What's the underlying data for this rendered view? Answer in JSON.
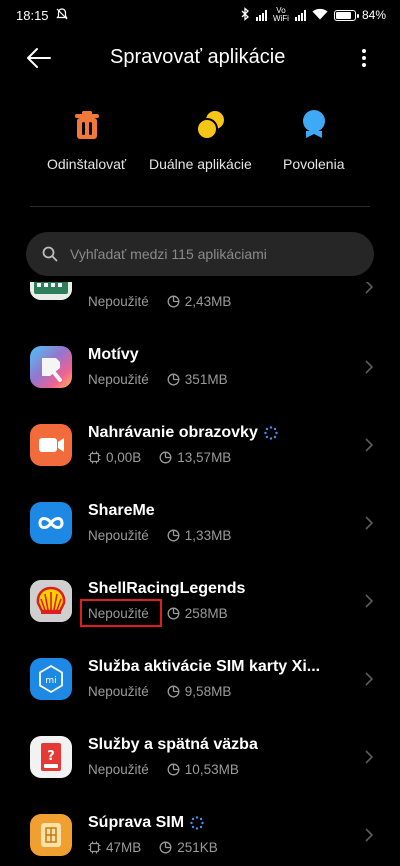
{
  "status": {
    "time": "18:15",
    "battery": "84",
    "battery_percent": 84
  },
  "header": {
    "title": "Spravovať aplikácie"
  },
  "actions": [
    {
      "label": "Odinštalovať",
      "icon": "trash-icon",
      "color": "#f2773a"
    },
    {
      "label": "Duálne aplikácie",
      "icon": "dual-apps-icon",
      "color": "#f5c518"
    },
    {
      "label": "Povolenia",
      "icon": "permissions-icon",
      "color": "#3fa9f5"
    }
  ],
  "search": {
    "placeholder": "Vyhľadať medzi 115 aplikáciami"
  },
  "apps": [
    {
      "name": "",
      "status": "Nepoužité",
      "size": "2,43MB",
      "icon": "partial-app-icon"
    },
    {
      "name": "Motívy",
      "status": "Nepoužité",
      "size": "351MB",
      "icon": "themes-icon"
    },
    {
      "name": "Nahrávanie obrazovky",
      "cpu": "0,00B",
      "size": "13,57MB",
      "icon": "screen-recorder-icon",
      "running": true
    },
    {
      "name": "ShareMe",
      "status": "Nepoužité",
      "size": "1,33MB",
      "icon": "shareme-icon"
    },
    {
      "name": "ShellRacingLegends",
      "status": "Nepoužité",
      "size": "258MB",
      "icon": "shell-icon",
      "highlighted": true
    },
    {
      "name": "Služba aktivácie SIM karty Xi...",
      "status": "Nepoužité",
      "size": "9,58MB",
      "icon": "mi-icon"
    },
    {
      "name": "Služby a spätná väzba",
      "status": "Nepoužité",
      "size": "10,53MB",
      "icon": "feedback-icon"
    },
    {
      "name": "Súprava SIM",
      "cpu": "47MB",
      "size": "251KB",
      "icon": "sim-toolkit-icon",
      "running": true
    }
  ]
}
